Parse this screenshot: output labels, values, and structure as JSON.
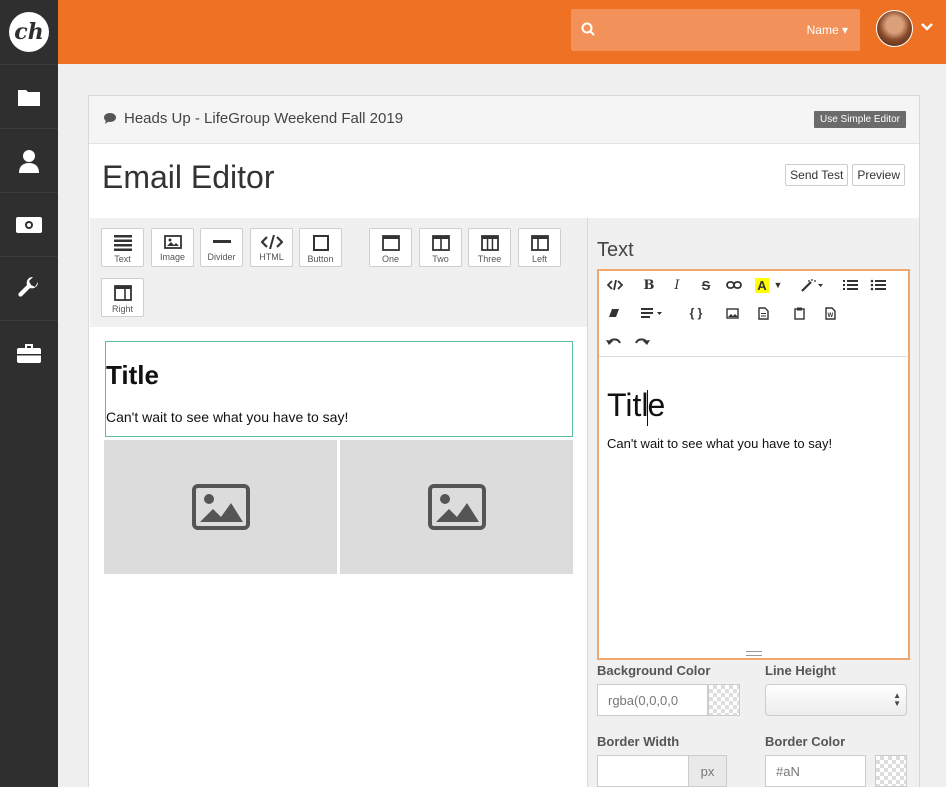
{
  "header": {
    "logo_text": "ch",
    "search_placeholder": "",
    "search_scope": "Name"
  },
  "sidebar": {
    "items": [
      {
        "icon": "folder-icon"
      },
      {
        "icon": "person-icon"
      },
      {
        "icon": "money-icon"
      },
      {
        "icon": "wrench-icon"
      },
      {
        "icon": "briefcase-icon"
      }
    ]
  },
  "panel": {
    "title": "Heads Up - LifeGroup Weekend Fall 2019",
    "simple_editor_label": "Use Simple Editor",
    "editor_title": "Email Editor",
    "send_test_label": "Send Test",
    "preview_label": "Preview"
  },
  "components": {
    "text": "Text",
    "image": "Image",
    "divider": "Divider",
    "html": "HTML",
    "button": "Button",
    "one": "One",
    "two": "Two",
    "three": "Three",
    "left": "Left",
    "right": "Right"
  },
  "canvas": {
    "title": "Title",
    "body": "Can't wait to see what you have to say!"
  },
  "properties": {
    "heading": "Text",
    "editor_title_before_caret": "Titl",
    "editor_title_after_caret": "e",
    "editor_body": "Can't wait to see what you have to say!",
    "bg_color_label": "Background Color",
    "bg_color_value": "rgba(0,0,0,0",
    "line_height_label": "Line Height",
    "border_width_label": "Border Width",
    "border_width_unit": "px",
    "border_color_label": "Border Color",
    "border_color_value": "#aN"
  },
  "colors": {
    "brand_orange": "#ee7124",
    "sidebar_bg": "#2f2f2f",
    "selection_green": "#5bbf9a",
    "editor_focus": "#f0a86e"
  }
}
